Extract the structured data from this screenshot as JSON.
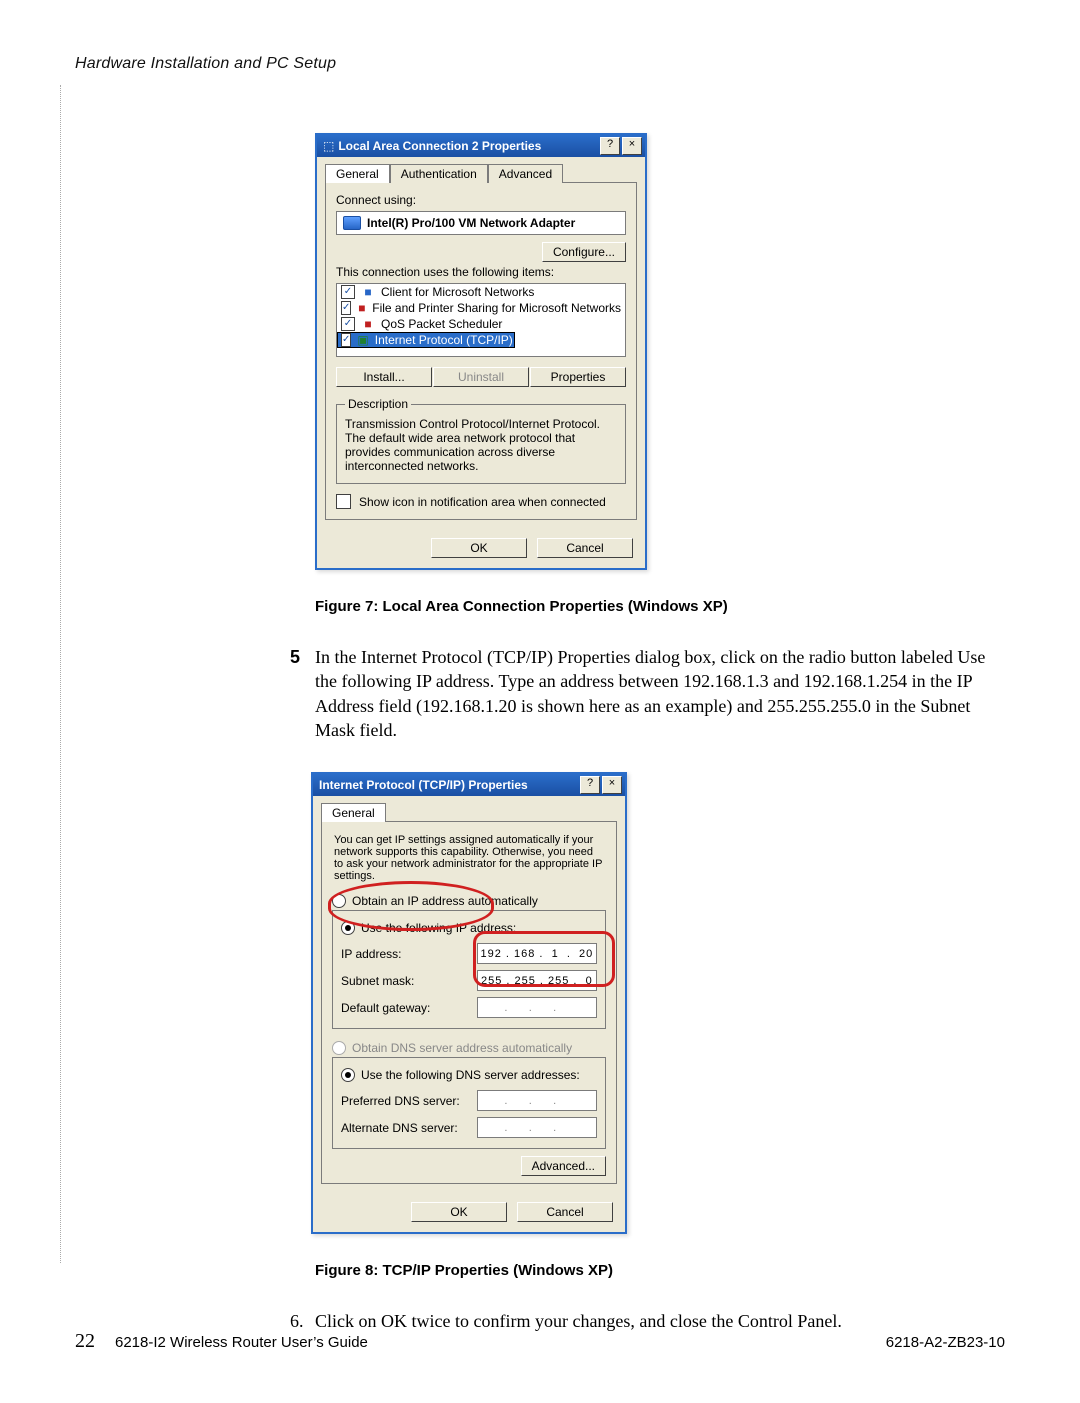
{
  "header": {
    "section": "Hardware Installation and PC Setup"
  },
  "dialog1": {
    "title": "Local Area Connection 2 Properties",
    "helpBtn": "?",
    "closeBtn": "×",
    "tabs": {
      "general": "General",
      "auth": "Authentication",
      "adv": "Advanced"
    },
    "connectUsing": "Connect using:",
    "adapter": "Intel(R) Pro/100 VM Network Adapter",
    "configure": "Configure...",
    "usesItems": "This connection uses the following items:",
    "items": {
      "client": "Client for Microsoft Networks",
      "filePrint": "File and Printer Sharing for Microsoft Networks",
      "qos": "QoS Packet Scheduler",
      "tcp": "Internet Protocol (TCP/IP)"
    },
    "install": "Install...",
    "uninstall": "Uninstall",
    "properties": "Properties",
    "descLegend": "Description",
    "descText": "Transmission Control Protocol/Internet Protocol. The default wide area network protocol that provides communication across diverse interconnected networks.",
    "showIcon": "Show icon in notification area when connected",
    "ok": "OK",
    "cancel": "Cancel"
  },
  "caption1": "Figure 7: Local Area Connection Properties (Windows XP)",
  "step5": {
    "num": "5",
    "text": "In the Internet Protocol (TCP/IP) Properties dialog box, click on the radio button labeled Use the following IP address. Type an address between 192.168.1.3 and 192.168.1.254 in the IP Address field (192.168.1.20 is shown here as an example) and 255.255.255.0 in the Subnet Mask field."
  },
  "dialog2": {
    "title": "Internet Protocol (TCP/IP) Properties",
    "helpBtn": "?",
    "closeBtn": "×",
    "tab": "General",
    "note": "You can get IP settings assigned automatically if your network supports this capability. Otherwise, you need to ask your network administrator for the appropriate IP settings.",
    "radioAuto": "Obtain an IP address automatically",
    "radioUse": "Use the following IP address:",
    "ipLabel": "IP address:",
    "ipValue": "192 . 168 .  1  .  20",
    "maskLabel": "Subnet mask:",
    "maskValue": "255 . 255 . 255 .  0",
    "gwLabel": "Default gateway:",
    "gwValue": " .     .     .    ",
    "radioDnsAuto": "Obtain DNS server address automatically",
    "radioDnsUse": "Use the following DNS server addresses:",
    "prefDns": "Preferred DNS server:",
    "altDns": "Alternate DNS server:",
    "advanced": "Advanced...",
    "ok": "OK",
    "cancel": "Cancel"
  },
  "caption2": "Figure 8: TCP/IP Properties (Windows XP)",
  "step6": {
    "num": "6.",
    "text": "Click on OK  twice to confirm your changes, and close the Control Panel."
  },
  "footer": {
    "page": "22",
    "guide": "6218-I2 Wireless Router User’s Guide",
    "doc": "6218-A2-ZB23-10"
  }
}
